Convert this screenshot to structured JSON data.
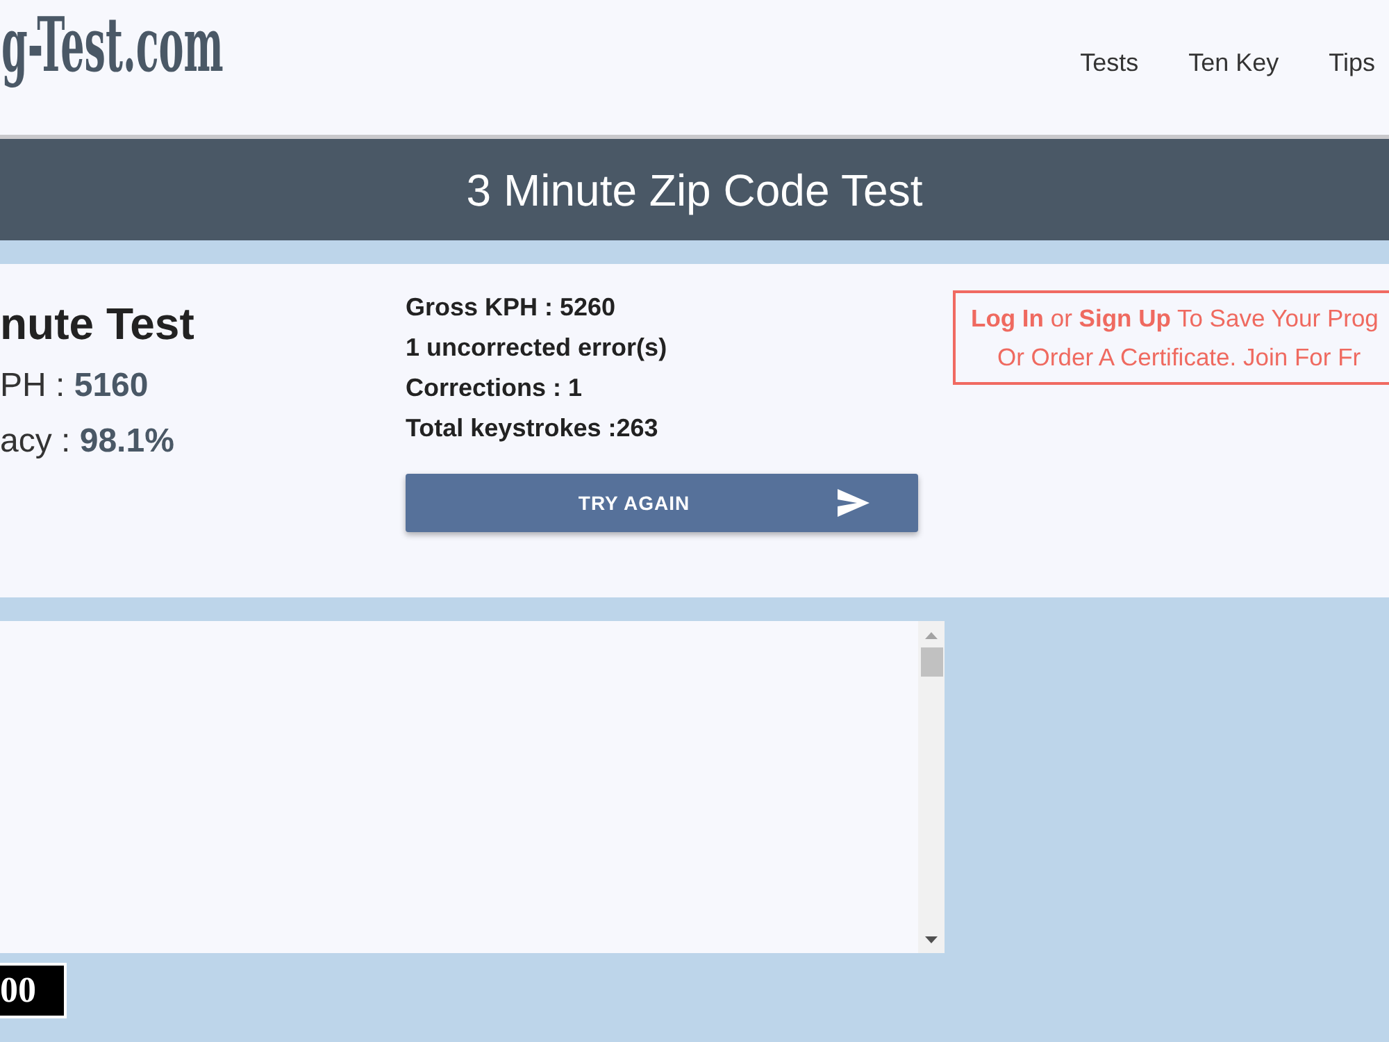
{
  "header": {
    "logo": "g-Test.com",
    "nav": [
      {
        "label": "Tests"
      },
      {
        "label": "Ten Key"
      },
      {
        "label": "Tips"
      }
    ]
  },
  "banner": {
    "title": "3 Minute Zip Code Test"
  },
  "results": {
    "heading": "nute Test",
    "stats": [
      {
        "label": "PH :",
        "value": "5160"
      },
      {
        "label": "acy :",
        "value": "98.1%"
      }
    ],
    "details": [
      "Gross KPH : 5260",
      "1 uncorrected error(s)",
      "Corrections : 1",
      "Total keystrokes :263"
    ],
    "button": {
      "label": "TRY AGAIN"
    }
  },
  "signup_notice": {
    "lines": [
      [
        {
          "kind": "link",
          "text": "Log In"
        },
        {
          "kind": "text",
          "text": "or"
        },
        {
          "kind": "link",
          "text": "Sign Up"
        },
        {
          "kind": "text",
          "text": "To Save Your Prog"
        }
      ],
      [
        {
          "kind": "text",
          "text": "Or Order A Certificate. Join For Fr"
        }
      ]
    ]
  },
  "counter_display": {
    "text": "00"
  }
}
